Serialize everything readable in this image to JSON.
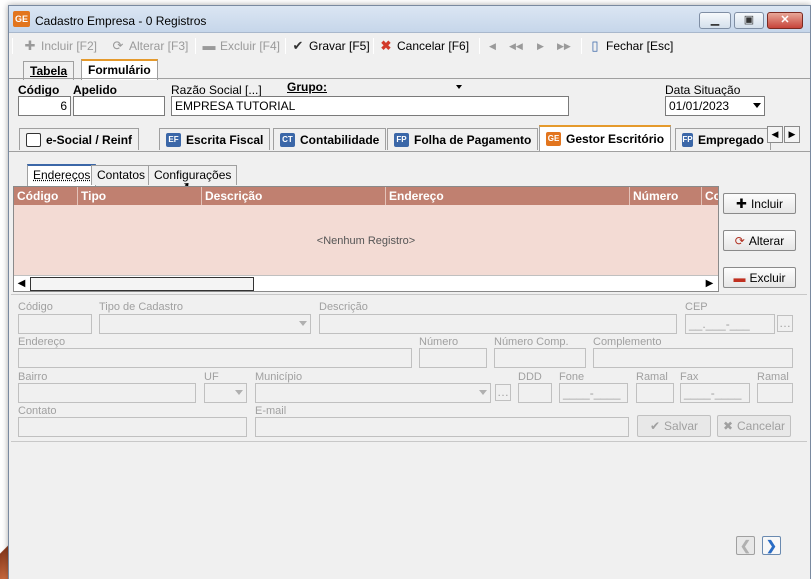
{
  "window": {
    "app_icon": "GE",
    "title": "Cadastro Empresa  - 0 Registros",
    "controls": {
      "minimize": "minimize-icon",
      "maximize": "maximize-icon",
      "close": "close-icon"
    }
  },
  "toolbar": {
    "incluir": "Incluir [F2]",
    "alterar": "Alterar [F3]",
    "excluir": "Excluir [F4]",
    "gravar": "Gravar [F5]",
    "cancelar": "Cancelar [F6]",
    "fechar": "Fechar [Esc]"
  },
  "main_tabs": [
    "Tabela",
    "Formulário"
  ],
  "header_fields": {
    "codigo_label": "Código",
    "codigo_value": "6",
    "apelido_label": "Apelido",
    "apelido_value": "",
    "razao_label": "Razão Social [...]",
    "grupo_label": "Grupo:",
    "razao_value": "EMPRESA TUTORIAL",
    "data_label": "Data Situação",
    "data_value": "01/01/2023"
  },
  "section_tabs": [
    {
      "icon": "",
      "label": "e-Social / Reinf"
    },
    {
      "icon": "EF",
      "label": "Escrita Fiscal"
    },
    {
      "icon": "CT",
      "label": "Contabilidade"
    },
    {
      "icon": "FP",
      "label": "Folha de Pagamento"
    },
    {
      "icon": "GE",
      "label": "Gestor Escritório"
    },
    {
      "icon": "FP",
      "label": "Empregado"
    }
  ],
  "sub_tabs": [
    "Endereços",
    "Contatos",
    "Configurações"
  ],
  "grid": {
    "columns": [
      "Código",
      "Tipo",
      "Descrição",
      "Endereço",
      "Número",
      "Co"
    ],
    "empty_text": "<Nenhum Registro>"
  },
  "side_buttons": {
    "incluir": "Incluir",
    "alterar": "Alterar",
    "excluir": "Excluir"
  },
  "form": {
    "codigo": "Código",
    "tipo_cadastro": "Tipo de Cadastro",
    "descricao": "Descrição",
    "cep": "CEP",
    "cep_mask": "__.___-___",
    "endereco": "Endereço",
    "numero": "Número",
    "numero_comp": "Número Comp.",
    "complemento": "Complemento",
    "bairro": "Bairro",
    "uf": "UF",
    "municipio": "Município",
    "ddd": "DDD",
    "fone": "Fone",
    "fone_mask": "____-____",
    "ramal": "Ramal",
    "fax": "Fax",
    "fax_mask": "____-____",
    "ramal2": "Ramal",
    "contato": "Contato",
    "email": "E-mail",
    "salvar": "Salvar",
    "cancelar": "Cancelar"
  }
}
